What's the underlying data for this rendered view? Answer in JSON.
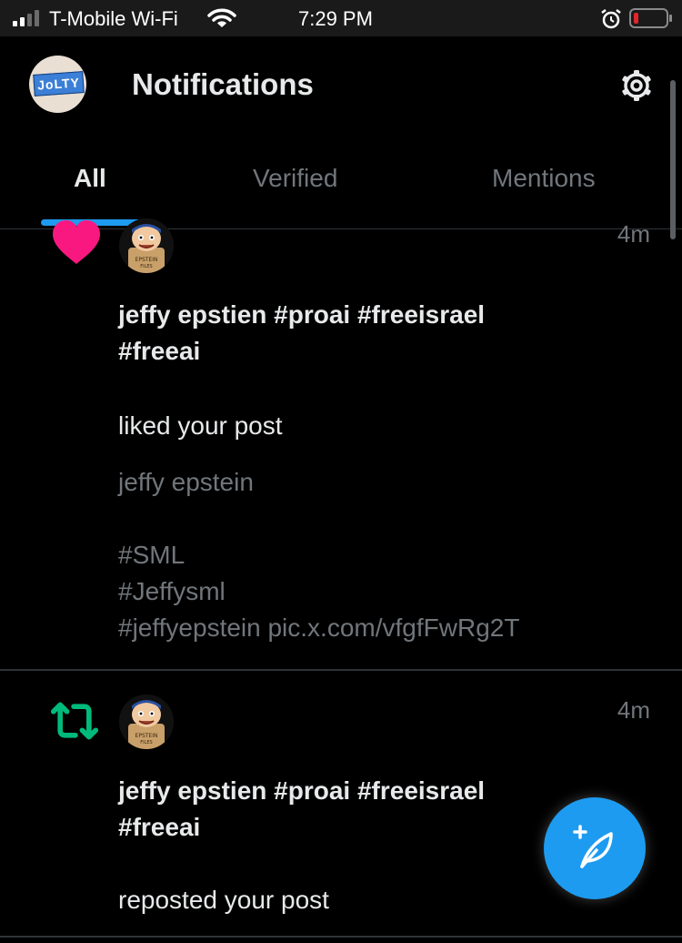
{
  "status_bar": {
    "carrier": "T-Mobile Wi-Fi",
    "time": "7:29 PM",
    "signal_icon": "cellular-signal-icon",
    "wifi_icon": "wifi-icon",
    "alarm_icon": "alarm-clock-icon",
    "battery_icon": "battery-low-icon",
    "battery_color": "#e0262b"
  },
  "header": {
    "avatar_text": "JoLTY",
    "title": "Notifications",
    "settings_icon": "gear-icon"
  },
  "tabs": [
    {
      "label": "All",
      "active": true
    },
    {
      "label": "Verified",
      "active": false
    },
    {
      "label": "Mentions",
      "active": false
    }
  ],
  "notifications": [
    {
      "type": "like",
      "icon": "heart-icon",
      "icon_color": "#f91880",
      "time": "4m",
      "actor_name": "jeffy epstien #proai #freeisrael #freeai",
      "action": "liked your post",
      "post_lines": [
        "jeffy epstein",
        "",
        "#SML",
        "#Jeffysml",
        "#jeffyepstein pic.x.com/vfgfFwRg2T"
      ]
    },
    {
      "type": "repost",
      "icon": "repost-icon",
      "icon_color": "#00ba7c",
      "time": "4m",
      "actor_name": "jeffy epstien #proai #freeisrael #freeai",
      "action": "reposted your post"
    }
  ],
  "fab": {
    "icon": "compose-post-icon",
    "color": "#1d9bf0"
  },
  "colors": {
    "accent": "#1d9bf0",
    "background": "#000000",
    "secondary_text": "#71767b"
  }
}
